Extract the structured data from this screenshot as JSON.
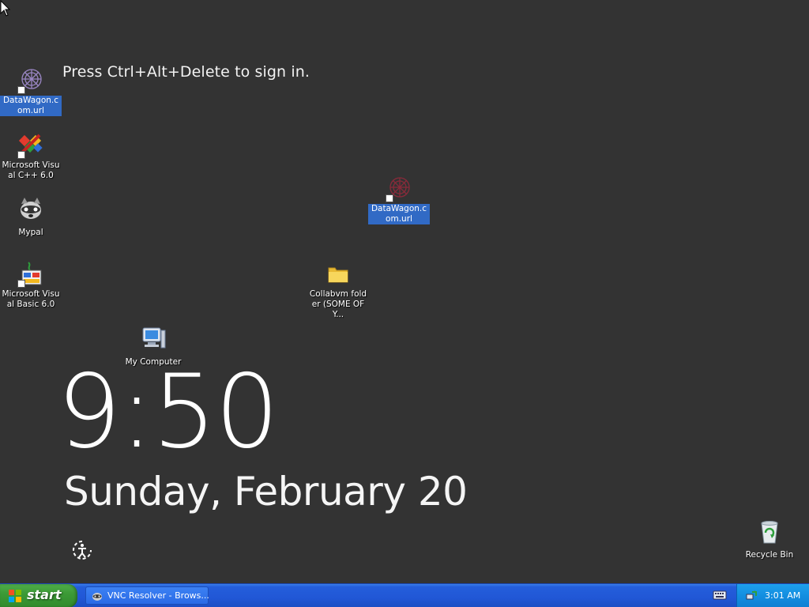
{
  "lock_screen": {
    "message": "Press Ctrl+Alt+Delete to sign in.",
    "time": "9:50",
    "date": "Sunday, February 20"
  },
  "desktop_icons": [
    {
      "label": "DataWagon.com.url",
      "icon": "datawagon-url-icon"
    },
    {
      "label": "Microsoft Visual C++ 6.0",
      "icon": "visual-cpp-icon"
    },
    {
      "label": "Mypal",
      "icon": "mypal-icon"
    },
    {
      "label": "Microsoft Visual Basic 6.0",
      "icon": "visual-basic-icon"
    },
    {
      "label": "My Computer",
      "icon": "my-computer-icon"
    },
    {
      "label": "DataWagon.com.url",
      "icon": "datawagon-url-icon"
    },
    {
      "label": "Collabvm folder (SOME OF Y...",
      "icon": "folder-icon"
    },
    {
      "label": "Recycle Bin",
      "icon": "recycle-bin-icon"
    }
  ],
  "taskbar": {
    "start_label": "start",
    "task_label": "VNC Resolver - Brows...",
    "clock": "3:01 AM"
  },
  "colors": {
    "desktop_bg": "#333333",
    "taskbar": "#245edb",
    "start_button": "#3c9a36",
    "tray": "#138ee0",
    "selection": "#316ac5"
  }
}
